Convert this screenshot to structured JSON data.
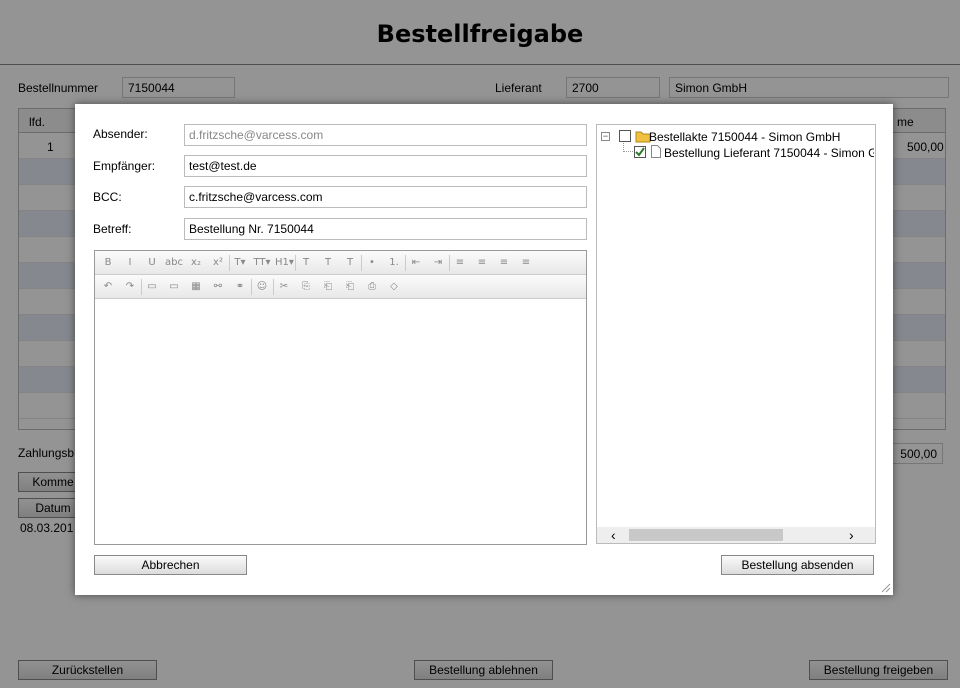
{
  "page": {
    "title": "Bestellfreigabe",
    "bestellnummer_label": "Bestellnummer",
    "bestellnummer_value": "7150044",
    "lieferant_label": "Lieferant",
    "lieferant_id": "2700",
    "lieferant_name": "Simon GmbH",
    "grid_col_lfd": "lfd.",
    "grid_col_summe_partial": "me",
    "grid_row1_lfd": "1",
    "grid_row1_sum": "500,00",
    "zahlung_label_partial": "Zahlungsb",
    "zahlung_value": "500,00",
    "komm_partial": "Komme",
    "datum_partial": "Datum",
    "date_partial": "08.03.201",
    "btn_zurueck": "Zurückstellen",
    "btn_ablehnen": "Bestellung ablehnen",
    "btn_freigeben": "Bestellung freigeben"
  },
  "dialog": {
    "absender_label": "Absender:",
    "absender_value": "d.fritzsche@varcess.com",
    "empfaenger_label": "Empfänger:",
    "empfaenger_value": "test@test.de",
    "bcc_label": "BCC:",
    "bcc_value": "c.fritzsche@varcess.com",
    "betreff_label": "Betreff:",
    "betreff_value": "Bestellung Nr. 7150044",
    "cancel_label": "Abbrechen",
    "send_label": "Bestellung absenden",
    "tree_root": "Bestellakte 7150044 - Simon GmbH",
    "tree_child": "Bestellung Lieferant 7150044 - Simon G",
    "toolbar1": [
      "B",
      "I",
      "U",
      "abc",
      "x₂",
      "x²",
      "T▾",
      "TT▾",
      "H1▾",
      "T",
      "T",
      "T",
      "•",
      "1.",
      "⇤",
      "⇥",
      "≡",
      "≡",
      "≡",
      "≡"
    ],
    "toolbar2": [
      "↶",
      "↷",
      "▭",
      "▭",
      "▦",
      "⚯",
      "⚭",
      "☺",
      "✂",
      "⎘",
      "⎗",
      "⎗",
      "⎙",
      "◇"
    ]
  },
  "colors": {
    "overlay": "#000000",
    "rowAlt": "#e6ecf7",
    "folder": "#f0c040",
    "check": "#2a7a2a"
  }
}
